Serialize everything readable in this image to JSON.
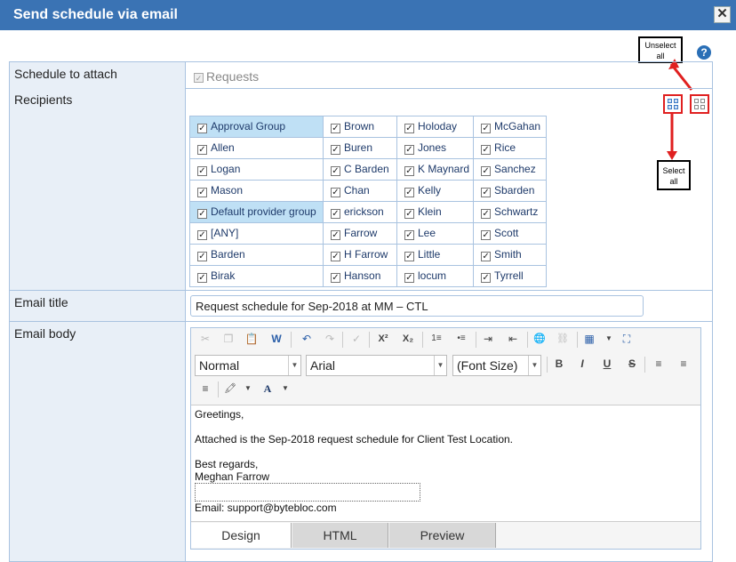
{
  "dialog": {
    "title": "Send schedule via email",
    "close_label": "✕"
  },
  "help": {
    "label": "?"
  },
  "annotations": {
    "unselect_all": "Unselect all",
    "select_all": "Select all"
  },
  "form": {
    "schedule_label": "Schedule to attach",
    "schedule_option": "Requests",
    "recipients_label": "Recipients",
    "email_title_label": "Email title",
    "email_title_value": "Request schedule for Sep-2018 at MM – CTL",
    "email_body_label": "Email body"
  },
  "recipients": {
    "rows": [
      [
        {
          "name": "Approval Group",
          "hl": true
        },
        {
          "name": "Brown"
        },
        {
          "name": "Holoday"
        },
        {
          "name": "McGahan"
        }
      ],
      [
        {
          "name": "Allen"
        },
        {
          "name": "Buren"
        },
        {
          "name": "Jones"
        },
        {
          "name": "Rice"
        }
      ],
      [
        {
          "name": "Logan"
        },
        {
          "name": "C Barden"
        },
        {
          "name": "K Maynard"
        },
        {
          "name": "Sanchez"
        }
      ],
      [
        {
          "name": "Mason"
        },
        {
          "name": "Chan"
        },
        {
          "name": "Kelly"
        },
        {
          "name": "Sbarden"
        }
      ],
      [
        {
          "name": "Default provider group",
          "hl": true
        },
        {
          "name": "erickson"
        },
        {
          "name": "Klein"
        },
        {
          "name": "Schwartz"
        }
      ],
      [
        {
          "name": "[ANY]"
        },
        {
          "name": "Farrow"
        },
        {
          "name": "Lee"
        },
        {
          "name": "Scott"
        }
      ],
      [
        {
          "name": "Barden"
        },
        {
          "name": "H Farrow"
        },
        {
          "name": "Little"
        },
        {
          "name": "Smith"
        }
      ],
      [
        {
          "name": "Birak"
        },
        {
          "name": "Hanson"
        },
        {
          "name": "locum"
        },
        {
          "name": "Tyrrell"
        }
      ]
    ]
  },
  "editor": {
    "format_value": "Normal",
    "font_value": "Arial",
    "size_value": "(Font Size)",
    "body": {
      "greeting": "Greetings,",
      "line1": "Attached is the Sep-2018 request schedule for Client Test Location.",
      "closing": "Best regards,",
      "signature": "Meghan Farrow",
      "email_line": "Email: support@bytebloc.com"
    },
    "tabs": [
      "Design",
      "HTML",
      "Preview"
    ],
    "toolbar_glyphs": {
      "cut": "✂",
      "copy": "❐",
      "paste": "📋",
      "paste_word": "W",
      "undo": "↶",
      "redo": "↷",
      "spell": "✓",
      "superscript": "X²",
      "subscript": "X₂",
      "ordered_list": "1≡",
      "unordered_list": "•≡",
      "indent": "⇥",
      "outdent": "⇤",
      "link": "🌐",
      "unlink": "⛓",
      "table": "▦",
      "expand": "⛶",
      "bold": "B",
      "italic": "I",
      "underline": "U",
      "strike": "S",
      "align_left": "≡",
      "align_center": "≡",
      "justify": "≡",
      "highlight": "🖍",
      "font_color": "A"
    }
  },
  "colors": {
    "titlebar": "#3a73b4",
    "label_bg": "#e8eff7",
    "highlight": "#bfe0f5",
    "annotation_red": "#e02020"
  }
}
